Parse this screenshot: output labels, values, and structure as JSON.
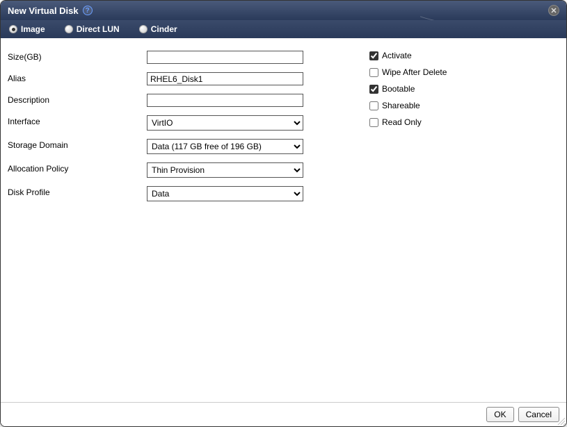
{
  "title": "New Virtual Disk",
  "tabs": [
    {
      "label": "Image",
      "selected": true
    },
    {
      "label": "Direct LUN",
      "selected": false
    },
    {
      "label": "Cinder",
      "selected": false
    }
  ],
  "fields": {
    "size": {
      "label": "Size(GB)",
      "value": ""
    },
    "alias": {
      "label": "Alias",
      "value": "RHEL6_Disk1"
    },
    "description": {
      "label": "Description",
      "value": ""
    },
    "interface": {
      "label": "Interface",
      "value": "VirtIO"
    },
    "storage_domain": {
      "label": "Storage Domain",
      "value": "Data (117 GB free of 196 GB)"
    },
    "allocation_policy": {
      "label": "Allocation Policy",
      "value": "Thin Provision"
    },
    "disk_profile": {
      "label": "Disk Profile",
      "value": "Data"
    }
  },
  "checks": {
    "activate": {
      "label": "Activate",
      "checked": true
    },
    "wipe_after_delete": {
      "label": "Wipe After Delete",
      "checked": false
    },
    "bootable": {
      "label": "Bootable",
      "checked": true
    },
    "shareable": {
      "label": "Shareable",
      "checked": false
    },
    "read_only": {
      "label": "Read Only",
      "checked": false
    }
  },
  "buttons": {
    "ok": "OK",
    "cancel": "Cancel"
  }
}
